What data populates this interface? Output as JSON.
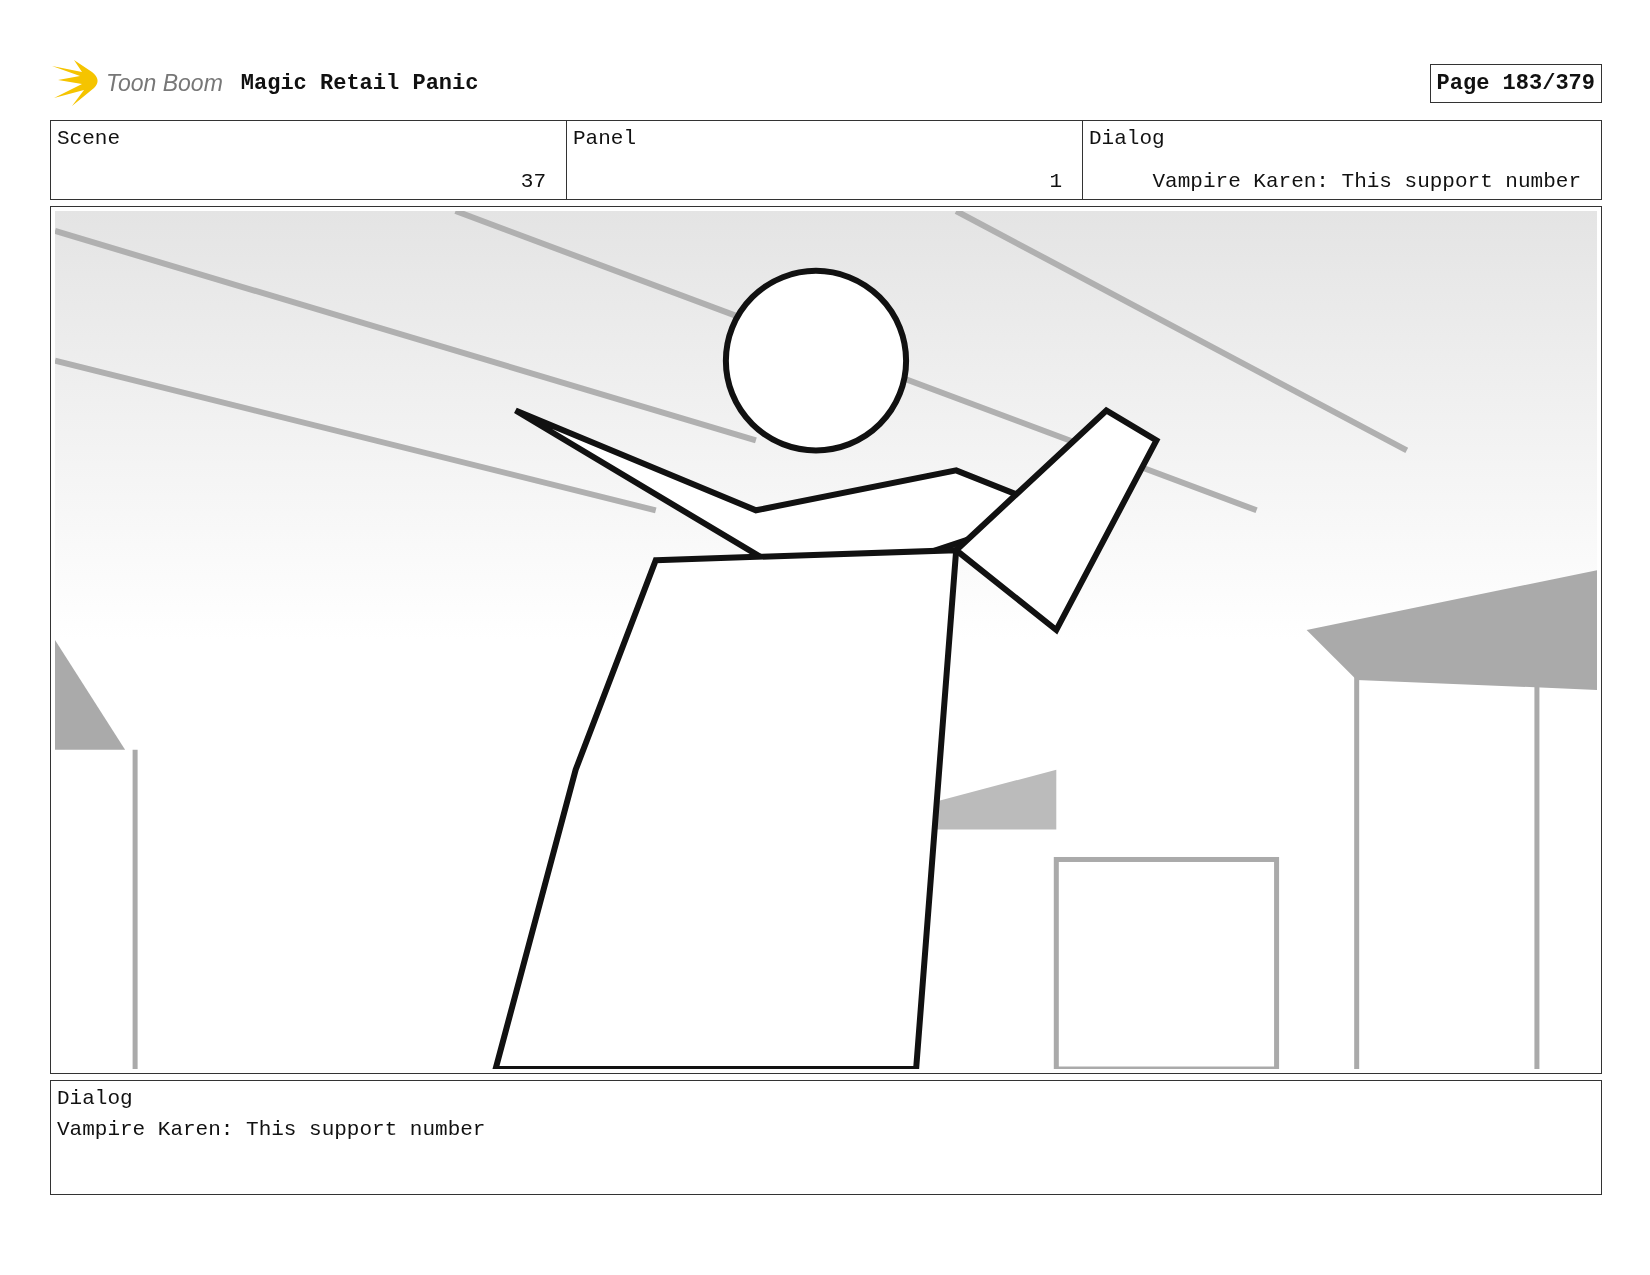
{
  "header": {
    "logo_text": "Toon Boom",
    "project_title": "Magic Retail Panic",
    "page": "Page 183/379"
  },
  "info_table": [
    {
      "label": "Scene",
      "value": "37"
    },
    {
      "label": "Panel",
      "value": "1"
    },
    {
      "label": "Dialog",
      "value": "Vampire Karen: This support number"
    }
  ],
  "dialog_box": {
    "label": "Dialog",
    "text": "Vampire Karen: This support number"
  }
}
